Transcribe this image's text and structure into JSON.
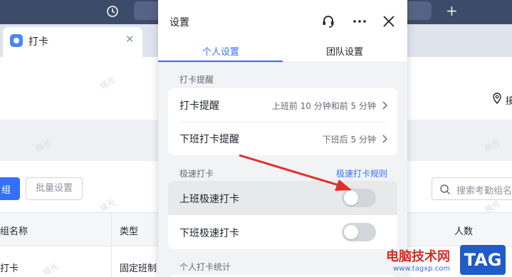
{
  "browser": {
    "tab_title": "打卡",
    "new_tab": "+"
  },
  "page": {
    "location_text": "接",
    "group_button": "组",
    "batch_button": "批量设置",
    "search_placeholder": "搜索考勤组名",
    "table": {
      "headers": [
        "组名称",
        "类型",
        "人数"
      ],
      "row": [
        "打卡",
        "固定班制"
      ]
    },
    "watermarks": [
      "极光",
      "极光",
      "极光",
      "极光",
      "极光",
      "极光"
    ]
  },
  "settings": {
    "title": "设置",
    "tabs": [
      {
        "label": "个人设置",
        "active": true
      },
      {
        "label": "团队设置",
        "active": false
      }
    ],
    "reminder_section": {
      "label": "打卡提醒",
      "rows": [
        {
          "label": "打卡提醒",
          "value": "上班前 10 分钟和前 5 分钟"
        },
        {
          "label": "下班打卡提醒",
          "value": "下班后 5 分钟"
        }
      ]
    },
    "quick_section": {
      "label": "极速打卡",
      "link": "极速打卡规则",
      "rows": [
        {
          "label": "上班极速打卡",
          "enabled": false
        },
        {
          "label": "下班极速打卡",
          "enabled": false
        }
      ]
    },
    "stats_section": {
      "label": "个人打卡统计"
    }
  },
  "badge": {
    "site": "电脑技术网",
    "url": "www.tagxp.com",
    "tag": "TAG"
  },
  "colors": {
    "accent": "#3370ff",
    "topbar": "#3c4b6a",
    "arrow": "#e0302c"
  }
}
